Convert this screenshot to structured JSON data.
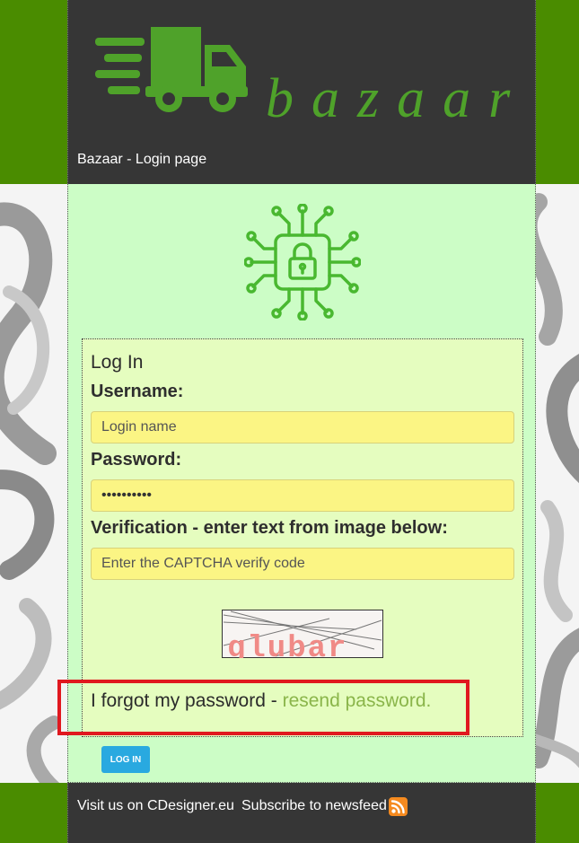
{
  "header": {
    "logo_text": "bazaar",
    "page_title": "Bazaar - Login page"
  },
  "login": {
    "heading": "Log In",
    "username_label": "Username:",
    "username_placeholder": "Login name",
    "password_label": "Password:",
    "password_value": "••••••••••",
    "verification_label": "Verification - enter text from image below:",
    "verification_placeholder": "Enter the CAPTCHA verify code",
    "captcha_text": "glubar",
    "forgot_text": "I forgot my password - ",
    "resend_link": "resend password.",
    "login_button": "LOG IN"
  },
  "footer": {
    "visit_link": "Visit us on CDesigner.eu",
    "subscribe_link": "Subscribe to newsfeed"
  },
  "icons": {
    "logo": "delivery-truck-icon",
    "security": "circuit-lock-icon",
    "feed": "rss-icon"
  },
  "colors": {
    "brand_green": "#4a8c00",
    "header_dark": "#363636",
    "content_bg": "#ccfdc6",
    "input_bg": "#fbf584",
    "link_green": "#8ab54a",
    "button_blue": "#29a9e0",
    "highlight_red": "#e0181f"
  }
}
